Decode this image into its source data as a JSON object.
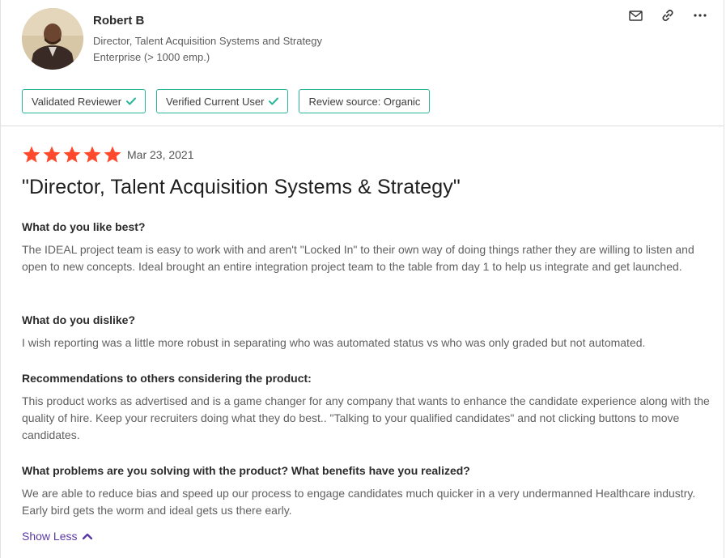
{
  "reviewer": {
    "name": "Robert B",
    "title": "Director, Talent Acquisition Systems and Strategy",
    "company_size": "Enterprise (> 1000 emp.)"
  },
  "actions": [
    "mail-icon",
    "link-icon",
    "more-icon"
  ],
  "badges": [
    {
      "label": "Validated Reviewer",
      "checked": true
    },
    {
      "label": "Verified Current User",
      "checked": true
    },
    {
      "label": "Review source: Organic",
      "checked": false
    }
  ],
  "review": {
    "rating": 5,
    "max_rating": 5,
    "date": "Mar 23, 2021",
    "title": "\"Director, Talent Acquisition Systems & Strategy\"",
    "sections": [
      {
        "question": "What do you like best?",
        "answer": "The IDEAL project team is easy to work with and aren't \"Locked In\" to their own way of doing things rather they are willing to listen and open to new concepts. Ideal brought an entire integration project team to the table from day 1 to help us integrate and get launched."
      },
      {
        "question": "What do you dislike?",
        "answer": "I wish reporting was a little more robust in separating who was automated status vs who was only graded but not automated."
      },
      {
        "question": "Recommendations to others considering the product:",
        "answer": "This product works as advertised and is a game changer for any company that wants to enhance the candidate experience along with the quality of hire. Keep your recruiters doing what they do best.. \"Talking to your qualified candidates\" and not clicking buttons to move candidates."
      },
      {
        "question": "What problems are you solving with the product? What benefits have you realized?",
        "answer": "We are able to reduce bias and speed up our process to engage candidates much quicker in a very undermanned Healthcare industry. Early bird gets the worm and ideal gets us there early."
      }
    ]
  },
  "show_less_label": "Show Less",
  "colors": {
    "star": "#ff492c",
    "badge_border": "#29b59a",
    "check": "#29b59a",
    "link": "#5a39a2"
  }
}
